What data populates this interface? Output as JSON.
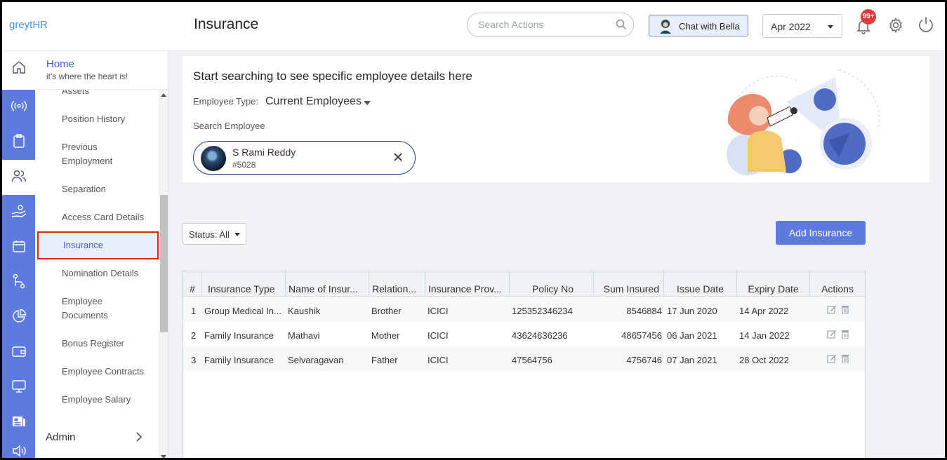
{
  "header": {
    "brand": "greytHR",
    "page_title": "Insurance",
    "search_placeholder": "Search Actions",
    "chat_label": "Chat with Bella",
    "month": "Apr 2022",
    "notif_count": "99+"
  },
  "sidebar": {
    "home_title": "Home",
    "home_subtitle": "it's where the heart is!",
    "menu": [
      "Assets",
      "Position History",
      "Previous Employment",
      "Separation",
      "Access Card Details",
      "Insurance",
      "Nomination Details",
      "Employee Documents",
      "Bonus Register",
      "Employee Contracts",
      "Employee Salary"
    ],
    "menu_lines": [
      {
        "l1": "Previous",
        "l2": "Employment"
      },
      {
        "l1": "Employee",
        "l2": "Documents"
      }
    ],
    "active_item": "Insurance",
    "admin": "Admin",
    "rail_icons": [
      "home-icon",
      "broadcast-icon",
      "clipboard-icon",
      "people-icon",
      "hand-coins-icon",
      "calendar-icon",
      "workflow-icon",
      "pie-chart-icon",
      "wallet-icon",
      "monitor-icon",
      "news-icon",
      "speaker-icon"
    ]
  },
  "search_card": {
    "heading": "Start searching to see specific employee details here",
    "employee_type_label": "Employee Type:",
    "employee_type_value": "Current Employees",
    "search_employee_label": "Search Employee",
    "employee_name": "S Rami Reddy",
    "employee_id": "#5028"
  },
  "controls": {
    "status": "Status: All",
    "add_button": "Add Insurance"
  },
  "table": {
    "columns": [
      "#",
      "Insurance Type",
      "Name of Insur...",
      "Relation...",
      "Insurance Prov...",
      "Policy No",
      "Sum Insured",
      "Issue Date",
      "Expiry Date",
      "Actions"
    ],
    "rows": [
      {
        "n": "1",
        "type": "Group Medical In...",
        "name": "Kaushik",
        "relation": "Brother",
        "provider": "ICICI",
        "policy": "125352346234",
        "sum": "8546884",
        "issue": "17 Jun 2020",
        "expiry": "14 Apr 2022"
      },
      {
        "n": "2",
        "type": "Family Insurance",
        "name": "Mathavi",
        "relation": "Mother",
        "provider": "ICICI",
        "policy": "43624636236",
        "sum": "48657456",
        "issue": "06 Jan 2021",
        "expiry": "14 Jan 2022"
      },
      {
        "n": "3",
        "type": "Family Insurance",
        "name": "Selvaragavan",
        "relation": "Father",
        "provider": "ICICI",
        "policy": "47564756",
        "sum": "4756746",
        "issue": "07 Jan 2021",
        "expiry": "28 Oct 2022"
      }
    ]
  },
  "colors": {
    "accent": "#5b7be0",
    "active_outline": "#e02020",
    "badge": "#e53935"
  }
}
